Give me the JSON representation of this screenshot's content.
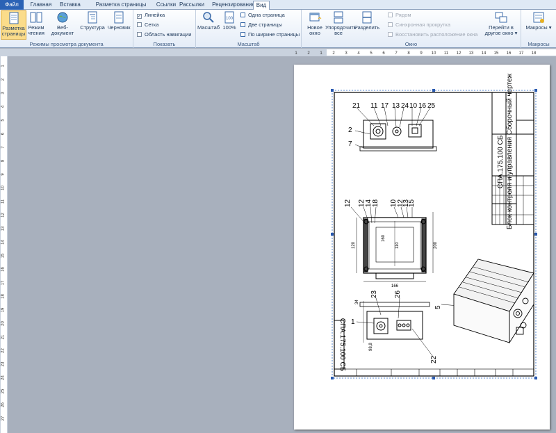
{
  "tabs": [
    "Файл",
    "Главная",
    "Вставка",
    "Разметка страницы",
    "Ссылки",
    "Рассылки",
    "Рецензирование",
    "Вид"
  ],
  "groups": {
    "view_modes": {
      "label": "Режимы просмотра документа",
      "buttons": [
        "Разметка страницы",
        "Режим чтения",
        "Веб-документ",
        "Структура",
        "Черновик"
      ]
    },
    "show": {
      "label": "Показать",
      "items": [
        {
          "label": "Линейка",
          "checked": true
        },
        {
          "label": "Сетка",
          "checked": false
        },
        {
          "label": "Область навигации",
          "checked": false
        }
      ]
    },
    "zoom": {
      "label": "Масштаб",
      "buttons": [
        "Масштаб",
        "100%"
      ],
      "items": [
        "Одна страница",
        "Две страницы",
        "По ширине страницы"
      ]
    },
    "window": {
      "label": "Окно",
      "buttons": [
        "Новое окно",
        "Упорядочить все",
        "Разделить"
      ],
      "items": [
        "Рядом",
        "Синхронная прокрутка",
        "Восстановить расположение окна"
      ],
      "switch": "Перейти в другое окно"
    },
    "macros": {
      "label": "Макросы",
      "button": "Макросы"
    }
  },
  "drawing": {
    "title": "СПА.175.100 СБ",
    "subtitle": "Блок контроля и управления Сборочный чертеж",
    "stamp": "СПА.175.100 СБ",
    "top_callouts": [
      "21",
      "11",
      "17",
      "13",
      "24",
      "10",
      "16",
      "25"
    ],
    "left_callouts_top": [
      "2",
      "7"
    ],
    "mid_callouts": [
      "12",
      "12",
      "14",
      "18",
      "10",
      "12",
      "13",
      "15"
    ],
    "lower_callouts": [
      "23",
      "26",
      "1",
      "5",
      "22"
    ],
    "dims": [
      "120",
      "200",
      "160",
      "110",
      "166",
      "90",
      "98,8",
      "34"
    ]
  },
  "ruler": {
    "h_ticks": [
      "1",
      "2",
      "1",
      "2",
      "3",
      "4",
      "5",
      "6",
      "7",
      "8",
      "9",
      "10",
      "11",
      "12",
      "13",
      "14",
      "15",
      "16",
      "17",
      "18"
    ],
    "v_ticks": [
      "1",
      "2",
      "3",
      "4",
      "5",
      "6",
      "7",
      "8",
      "9",
      "10",
      "11",
      "12",
      "13",
      "14",
      "15",
      "16",
      "17",
      "18",
      "19",
      "20",
      "21",
      "22",
      "23",
      "24",
      "25",
      "26",
      "27"
    ]
  }
}
